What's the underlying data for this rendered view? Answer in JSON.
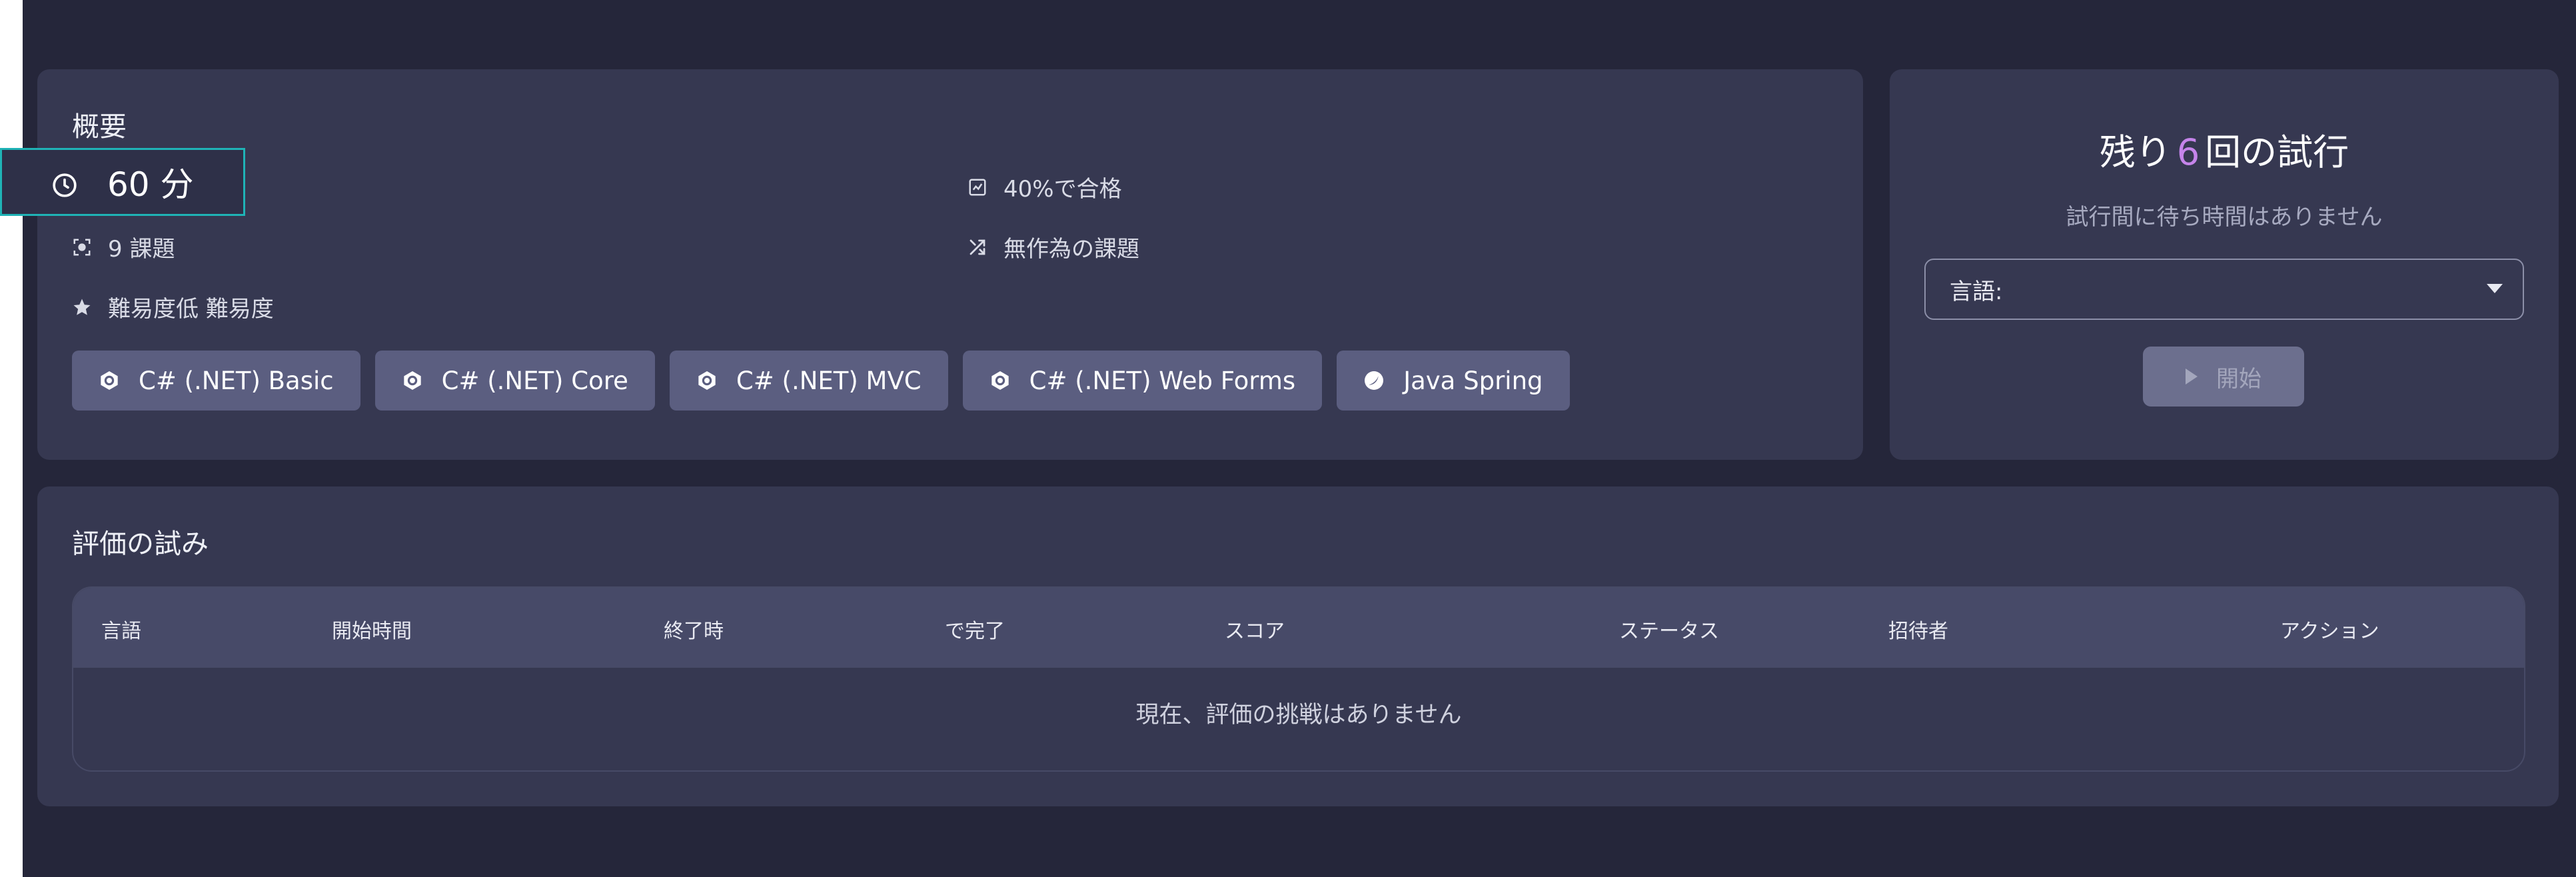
{
  "overview": {
    "title": "概要",
    "duration": "60 分",
    "pass_rate": "40%で合格",
    "tasks": "9 課題",
    "random": "無作為の課題",
    "difficulty": "難易度低 難易度",
    "tags": [
      {
        "label": "C# (.NET) Basic",
        "icon": "csharp-icon"
      },
      {
        "label": "C# (.NET) Core",
        "icon": "csharp-icon"
      },
      {
        "label": "C# (.NET) MVC",
        "icon": "csharp-icon"
      },
      {
        "label": "C# (.NET) Web Forms",
        "icon": "csharp-icon"
      },
      {
        "label": "Java Spring",
        "icon": "spring-icon"
      }
    ]
  },
  "attempts": {
    "prefix": "残り",
    "count": "6",
    "suffix": "回の試行",
    "wait_note": "試行間に待ち時間はありません",
    "language_label": "言語:",
    "start_label": "開始"
  },
  "history": {
    "title": "評価の試み",
    "columns": [
      "言語",
      "開始時間",
      "終了時",
      "で完了",
      "スコア",
      "ステータス",
      "招待者",
      "アクション"
    ],
    "empty_message": "現在、評価の挑戦はありません"
  },
  "colors": {
    "background": "#25263a",
    "panel": "#363851",
    "accent": "#c584ea",
    "highlight_border": "#1fb3b6",
    "tag": "#5b5e80"
  }
}
